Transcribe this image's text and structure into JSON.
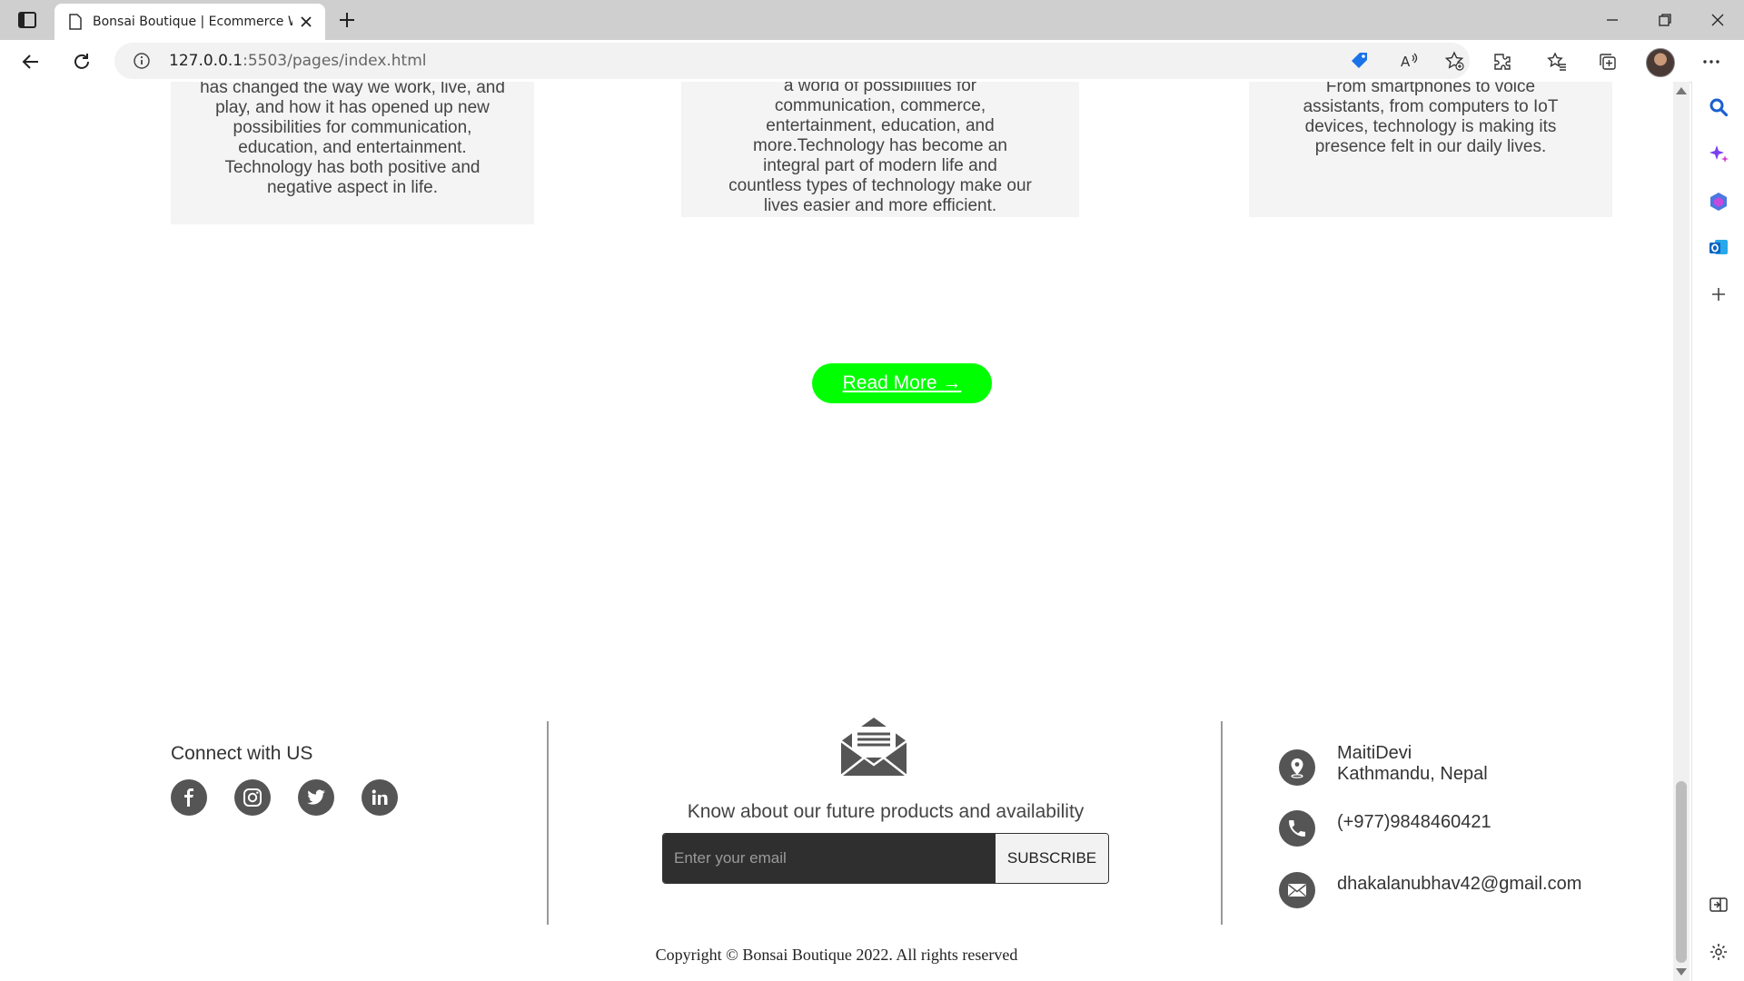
{
  "browser": {
    "tab_title": "Bonsai Boutique | Ecommerce W",
    "url_host": "127.0.0.1",
    "url_rest": ":5503/pages/index.html"
  },
  "cards": [
    {
      "lines": [
        "has changed the way we work, live, and",
        "play, and how it has opened up new",
        "possibilities for communication,",
        "education, and entertainment.",
        "Technology has both positive and",
        "negative aspect in life."
      ]
    },
    {
      "lines": [
        "a world of possibilities for",
        "communication, commerce,",
        "entertainment, education, and",
        "more.Technology has become an",
        "integral part of modern life and",
        "countless types of technology make our",
        "lives easier and more efficient."
      ]
    },
    {
      "lines": [
        "From smartphones to voice",
        "assistants, from computers to IoT",
        "devices, technology is making its",
        "presence felt in our daily lives."
      ]
    }
  ],
  "read_more_label": "Read More →",
  "footer": {
    "connect_title": "Connect with US",
    "social": [
      "facebook",
      "instagram",
      "twitter",
      "linkedin"
    ],
    "newsletter_text": "Know about our future products and availability",
    "email_placeholder": "Enter your email",
    "subscribe_label": "SUBSCRIBE",
    "address_line1": "MaitiDevi",
    "address_line2": "Kathmandu, Nepal",
    "phone": "(+977)9848460421",
    "email": "dhakalanubhav42@gmail.com",
    "copyright": "Copyright © Bonsai Boutique 2022. All rights reserved"
  },
  "colors": {
    "accent": "#00ff00",
    "icon_gray": "#555555",
    "card_bg": "#f4f4f4"
  }
}
